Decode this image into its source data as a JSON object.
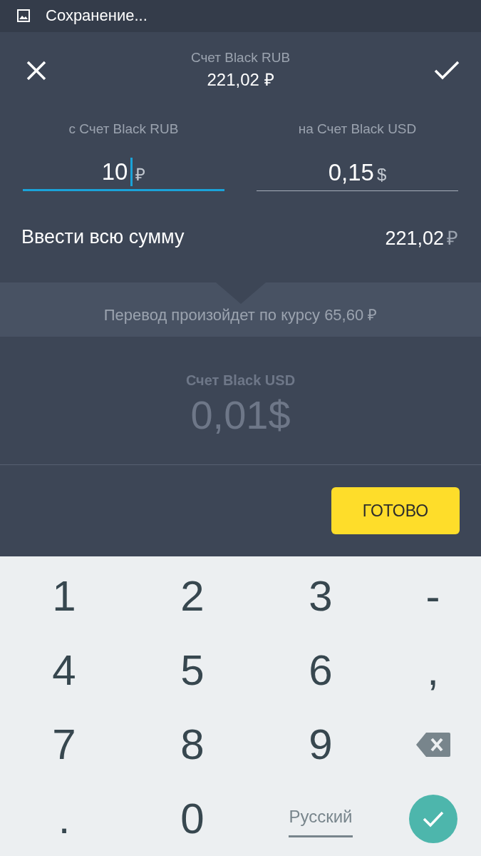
{
  "status_bar": {
    "text": "Сохранение..."
  },
  "header": {
    "account": "Счет Black RUB",
    "balance": "221,02 ₽"
  },
  "background": {
    "account": "Счет Black USD",
    "amount": "0,01$"
  },
  "fields": [
    {
      "label": "с Счет Black RUB",
      "value": "10",
      "currency": "₽",
      "focused": true
    },
    {
      "label": "на Счет Black USD",
      "value": "0,15",
      "currency": "$",
      "focused": false
    }
  ],
  "full_amount": {
    "label": "Ввести всю сумму",
    "value": "221,02",
    "currency": "₽"
  },
  "rate_note": "Перевод произойдет по курсу 65,60 ₽",
  "done_button": "ГОТОВО",
  "keyboard": [
    {
      "kind": "char",
      "label": "1"
    },
    {
      "kind": "char",
      "label": "2"
    },
    {
      "kind": "char",
      "label": "3"
    },
    {
      "kind": "char",
      "label": "-"
    },
    {
      "kind": "char",
      "label": "4"
    },
    {
      "kind": "char",
      "label": "5"
    },
    {
      "kind": "char",
      "label": "6"
    },
    {
      "kind": "char",
      "label": ","
    },
    {
      "kind": "char",
      "label": "7"
    },
    {
      "kind": "char",
      "label": "8"
    },
    {
      "kind": "char",
      "label": "9"
    },
    {
      "kind": "backspace"
    },
    {
      "kind": "char",
      "label": "."
    },
    {
      "kind": "char",
      "label": "0"
    },
    {
      "kind": "language",
      "label": "Русский"
    },
    {
      "kind": "enter"
    }
  ]
}
